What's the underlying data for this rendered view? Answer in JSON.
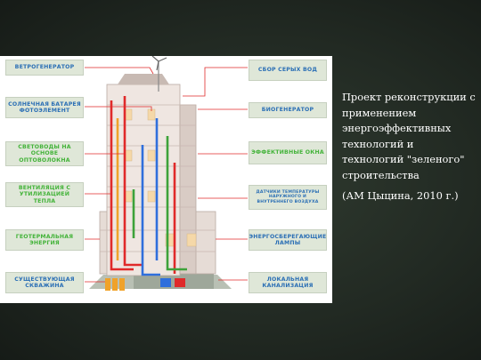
{
  "diagram": {
    "colors": {
      "text_blue": "#2b6fb5",
      "text_green": "#43b339",
      "label_bg": "#dfe7d8",
      "pipe_red": "#e02a2a",
      "pipe_blue": "#2f6fdc",
      "pipe_green": "#3da23a",
      "pipe_orange": "#f0a22a"
    },
    "labels_left": [
      {
        "text": "ВЕТРОГЕНЕРАТОР",
        "color": "#2b6fb5"
      },
      {
        "text": "СОЛНЕЧНАЯ БАТАРЕЯ ФОТОЭЛЕМЕНТ",
        "color": "#2b6fb5"
      },
      {
        "text": "СВЕТОВОДЫ НА ОСНОВЕ ОПТОВОЛОКНА",
        "color": "#43b339"
      },
      {
        "text": "ВЕНТИЛЯЦИЯ С УТИЛИЗАЦИЕЙ ТЕПЛА",
        "color": "#43b339"
      },
      {
        "text": "ГЕОТЕРМАЛЬНАЯ ЭНЕРГИЯ",
        "color": "#43b339"
      },
      {
        "text": "СУЩЕСТВУЮЩАЯ СКВАЖИНА",
        "color": "#2b6fb5"
      }
    ],
    "labels_right": [
      {
        "text": "СБОР СЕРЫХ ВОД",
        "color": "#2b6fb5"
      },
      {
        "text": "БИОГЕНЕРАТОР",
        "color": "#2b6fb5"
      },
      {
        "text": "ЭФФЕКТИВНЫЕ ОКНА",
        "color": "#43b339"
      },
      {
        "text": "ДАТЧИКИ ТЕМПЕРАТУРЫ НАРУЖНОГО И ВНУТРЕННЕГО ВОЗДУХА",
        "color": "#2b6fb5"
      },
      {
        "text": "ЭНЕРГОСБЕРЕГАЮЩИЕ ЛАМПЫ",
        "color": "#2b6fb5"
      },
      {
        "text": "ЛОКАЛЬНАЯ КАНАЛИЗАЦИЯ",
        "color": "#2b6fb5"
      }
    ]
  },
  "caption": {
    "main": "Проект реконструкции с применением энергоэффективных технологий и технологий \"зеленого\" строительства",
    "note": "(АМ Цыцина, 2010 г.)"
  }
}
